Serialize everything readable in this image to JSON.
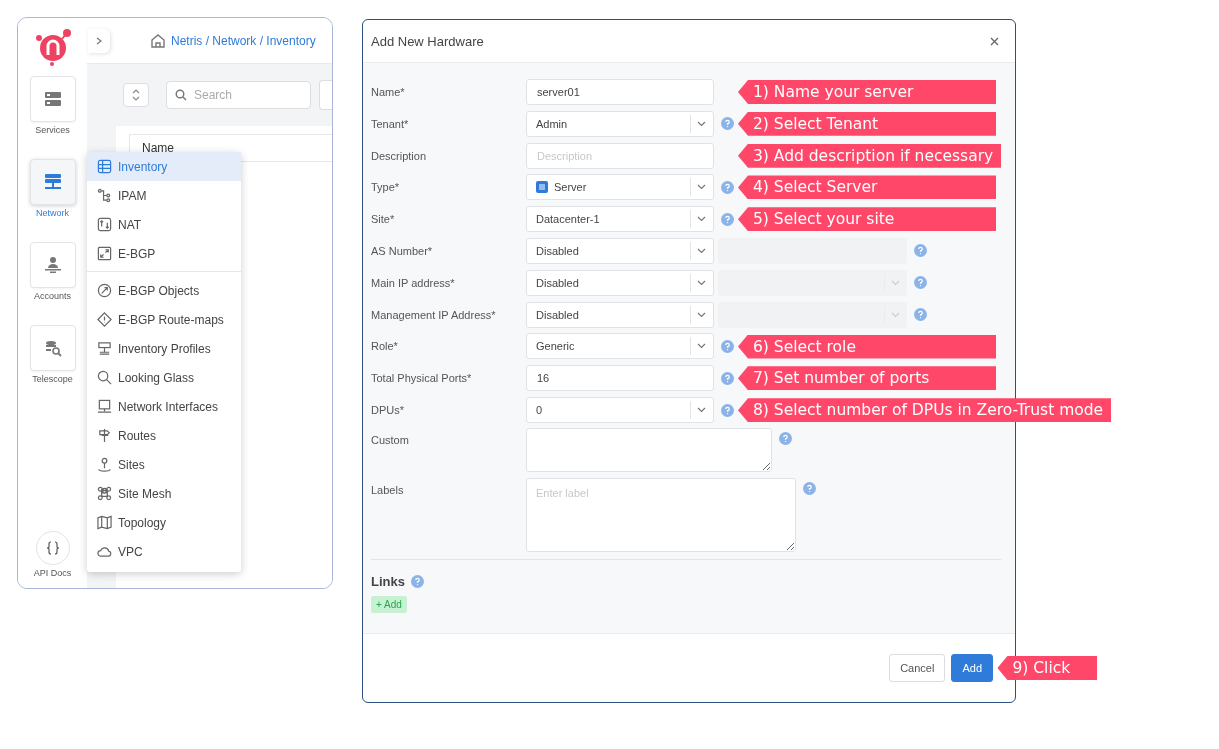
{
  "sidebar": {
    "nav": [
      {
        "label": "Services",
        "selected": false
      },
      {
        "label": "Network",
        "selected": true
      },
      {
        "label": "Accounts",
        "selected": false
      },
      {
        "label": "Telescope",
        "selected": false
      }
    ],
    "api_docs": "API Docs"
  },
  "breadcrumb": "Netris / Network / Inventory",
  "search": {
    "placeholder": "Search"
  },
  "table": {
    "columns": [
      "Name"
    ]
  },
  "menu": {
    "groups": [
      [
        {
          "label": "Inventory",
          "selected": true
        },
        {
          "label": "IPAM",
          "selected": false
        },
        {
          "label": "NAT",
          "selected": false
        },
        {
          "label": "E-BGP",
          "selected": false
        }
      ],
      [
        {
          "label": "E-BGP Objects",
          "selected": false
        },
        {
          "label": "E-BGP Route-maps",
          "selected": false
        },
        {
          "label": "Inventory Profiles",
          "selected": false
        },
        {
          "label": "Looking Glass",
          "selected": false
        },
        {
          "label": "Network Interfaces",
          "selected": false
        },
        {
          "label": "Routes",
          "selected": false
        },
        {
          "label": "Sites",
          "selected": false
        },
        {
          "label": "Site Mesh",
          "selected": false
        },
        {
          "label": "Topology",
          "selected": false
        },
        {
          "label": "VPC",
          "selected": false
        }
      ]
    ]
  },
  "dialog": {
    "title": "Add New Hardware",
    "fields": [
      {
        "label": "Name*",
        "kind": "input",
        "value": "server01",
        "help": false,
        "callout": "1) Name your server"
      },
      {
        "label": "Tenant*",
        "kind": "select",
        "value": "Admin",
        "help": true,
        "callout": "2) Select Tenant"
      },
      {
        "label": "Description",
        "kind": "input",
        "placeholder": "Description",
        "help": false,
        "callout": "3) Add description if necessary"
      },
      {
        "label": "Type*",
        "kind": "select",
        "value": "Server",
        "value_icon": true,
        "help": true,
        "callout": "4) Select Server"
      },
      {
        "label": "Site*",
        "kind": "select",
        "value": "Datacenter-1",
        "help": true,
        "callout": "5) Select your site"
      },
      {
        "label": "AS Number*",
        "kind": "select",
        "value": "Disabled",
        "extra": {
          "kind": "input"
        },
        "help": true
      },
      {
        "label": "Main IP address*",
        "kind": "select",
        "value": "Disabled",
        "extra": {
          "kind": "select"
        },
        "help": true
      },
      {
        "label": "Management IP Address*",
        "kind": "select",
        "value": "Disabled",
        "extra": {
          "kind": "select"
        },
        "help": true
      },
      {
        "label": "Role*",
        "kind": "select",
        "value": "Generic",
        "help": true,
        "callout": "6) Select role"
      },
      {
        "label": "Total Physical Ports*",
        "kind": "input",
        "value": "16",
        "help": true,
        "callout": "7) Set number of ports"
      },
      {
        "label": "DPUs*",
        "kind": "select",
        "value": "0",
        "help": true,
        "callout": "8) Select number of DPUs in Zero-Trust mode"
      },
      {
        "label": "Custom",
        "kind": "textarea",
        "help": true
      },
      {
        "label": "Labels",
        "kind": "labels",
        "placeholder": "Enter label",
        "help": true
      }
    ],
    "links": {
      "title": "Links",
      "add_button": "+ Add"
    },
    "buttons": [
      {
        "label": "Cancel",
        "kind": "secondary"
      },
      {
        "label": "Add",
        "kind": "primary",
        "callout": "9) Click"
      }
    ]
  }
}
